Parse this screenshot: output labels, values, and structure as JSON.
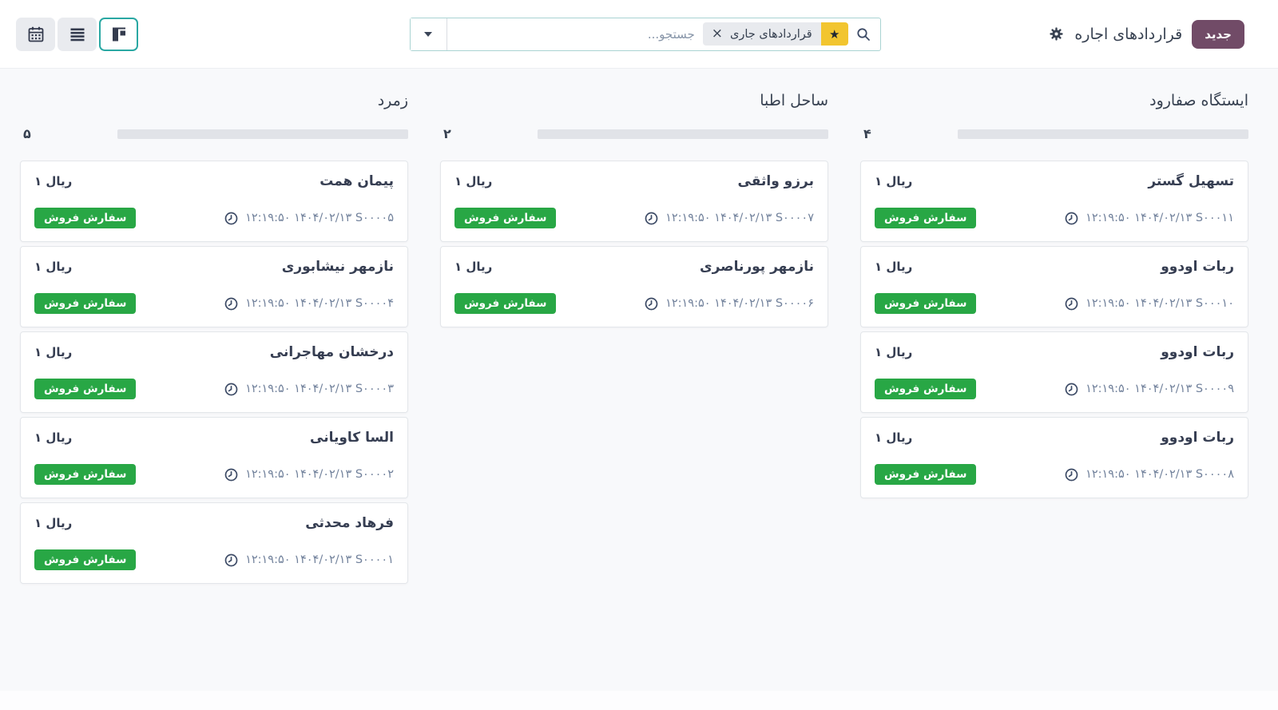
{
  "header": {
    "new_button_label": "جدید",
    "title": "قراردادهای اجاره",
    "settings_icon": "gear-icon",
    "search": {
      "placeholder": "جستجو...",
      "search_icon": "magnifier-icon",
      "facet": {
        "star_icon": "★",
        "label": "قراردادهای جاری",
        "remove_icon": "×"
      },
      "dropdown_icon": "caret-down-icon"
    },
    "view_switcher": [
      {
        "name": "calendar-view",
        "icon": "calendar-icon",
        "active": false
      },
      {
        "name": "list-view",
        "icon": "list-icon",
        "active": false
      },
      {
        "name": "kanban-view",
        "icon": "kanban-icon",
        "active": true
      }
    ]
  },
  "colors": {
    "primary_button": "#714b67",
    "badge_success": "#28a745",
    "facet_star_bg": "#f2c52f",
    "active_view_border": "#2aa8a3",
    "progress_bar": "#e1e3e8",
    "page_background": "#f8f9fb"
  },
  "board": {
    "columns": [
      {
        "title": "ایستگاه صفارود",
        "count": "۴",
        "cards": [
          {
            "name": "تسهیل گستر",
            "amount": "۱ ریال",
            "ref": "۱۲:۱۹:۵۰ ۱۴۰۴/۰۲/۱۳ S۰۰۰۱۱",
            "badge": "سفارش فروش"
          },
          {
            "name": "ربات اودوو",
            "amount": "۱ ریال",
            "ref": "۱۲:۱۹:۵۰ ۱۴۰۴/۰۲/۱۳ S۰۰۰۱۰",
            "badge": "سفارش فروش"
          },
          {
            "name": "ربات اودوو",
            "amount": "۱ ریال",
            "ref": "۱۲:۱۹:۵۰ ۱۴۰۴/۰۲/۱۳ S۰۰۰۰۹",
            "badge": "سفارش فروش"
          },
          {
            "name": "ربات اودوو",
            "amount": "۱ ریال",
            "ref": "۱۲:۱۹:۵۰ ۱۴۰۴/۰۲/۱۳ S۰۰۰۰۸",
            "badge": "سفارش فروش"
          }
        ]
      },
      {
        "title": "ساحل اطبا",
        "count": "۲",
        "cards": [
          {
            "name": "برزو واثقی",
            "amount": "۱ ریال",
            "ref": "۱۲:۱۹:۵۰ ۱۴۰۴/۰۲/۱۳ S۰۰۰۰۷",
            "badge": "سفارش فروش"
          },
          {
            "name": "نازمهر پورناصری",
            "amount": "۱ ریال",
            "ref": "۱۲:۱۹:۵۰ ۱۴۰۴/۰۲/۱۳ S۰۰۰۰۶",
            "badge": "سفارش فروش"
          }
        ]
      },
      {
        "title": "زمرد",
        "count": "۵",
        "cards": [
          {
            "name": "پیمان همت",
            "amount": "۱ ریال",
            "ref": "۱۲:۱۹:۵۰ ۱۴۰۴/۰۲/۱۳ S۰۰۰۰۵",
            "badge": "سفارش فروش"
          },
          {
            "name": "نازمهر نیشابوری",
            "amount": "۱ ریال",
            "ref": "۱۲:۱۹:۵۰ ۱۴۰۴/۰۲/۱۳ S۰۰۰۰۴",
            "badge": "سفارش فروش"
          },
          {
            "name": "درخشان مهاجرانی",
            "amount": "۱ ریال",
            "ref": "۱۲:۱۹:۵۰ ۱۴۰۴/۰۲/۱۳ S۰۰۰۰۳",
            "badge": "سفارش فروش"
          },
          {
            "name": "السا کاویانی",
            "amount": "۱ ریال",
            "ref": "۱۲:۱۹:۵۰ ۱۴۰۴/۰۲/۱۳ S۰۰۰۰۲",
            "badge": "سفارش فروش"
          },
          {
            "name": "فرهاد محدثی",
            "amount": "۱ ریال",
            "ref": "۱۲:۱۹:۵۰ ۱۴۰۴/۰۲/۱۳ S۰۰۰۰۱",
            "badge": "سفارش فروش"
          }
        ]
      }
    ]
  }
}
